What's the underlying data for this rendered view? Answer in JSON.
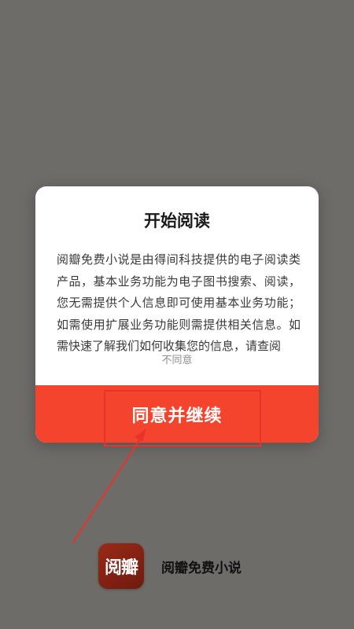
{
  "dialog": {
    "title": "开始阅读",
    "body": "阅瓣免费小说是由得间科技提供的电子阅读类产品，基本业务功能为电子图书搜索、阅读，您无需提供个人信息即可使用基本业务功能；如需使用扩展业务功能则需提供相关信息。如需快速了解我们如何收集您的信息，请查阅",
    "decline_label": "不同意",
    "agree_label": "同意并继续"
  },
  "brand": {
    "logo_text": "阅瓣",
    "app_name": "阅瓣免费小说"
  },
  "colors": {
    "overlay": "#6e6c69",
    "accent": "#f5442d",
    "annotation": "#e8332a",
    "logo": "#8a2413"
  }
}
